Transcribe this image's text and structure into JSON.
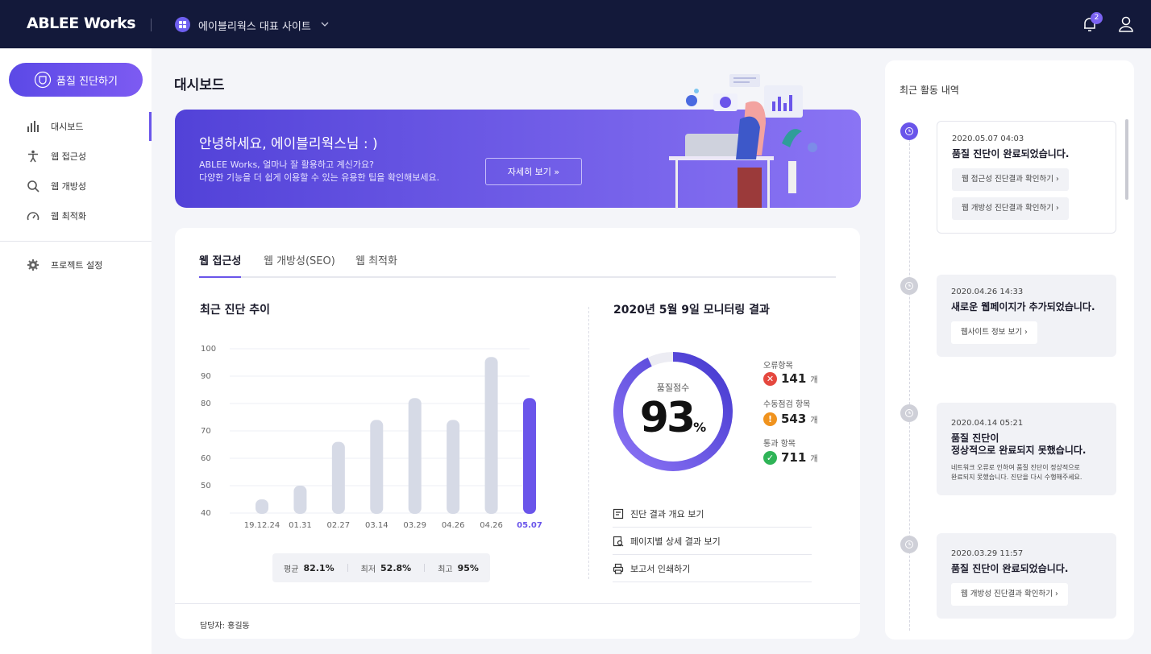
{
  "header": {
    "logo": "ABLEE Works",
    "site_name": "에이블리웍스 대표 사이트",
    "notification_count": "2"
  },
  "sidebar": {
    "cta_label": "품질 진단하기",
    "items": [
      {
        "label": "대시보드",
        "icon": "bar-chart-icon"
      },
      {
        "label": "웹 접근성",
        "icon": "accessibility-icon"
      },
      {
        "label": "웹 개방성",
        "icon": "search-icon"
      },
      {
        "label": "웹 최적화",
        "icon": "gauge-icon"
      },
      {
        "label": "프로젝트 설정",
        "icon": "gear-icon"
      }
    ]
  },
  "main": {
    "title": "대시보드",
    "banner": {
      "greeting": "안녕하세요, 에이블리웍스님 : )",
      "line1": "ABLEE Works, 얼마나 잘 활용하고 계신가요?",
      "line2": "다양한 기능을 더 쉽게 이용할 수 있는 유용한 팁을 확인해보세요.",
      "button": "자세히 보기 »"
    },
    "tabs": [
      "웹 접근성",
      "웹 개방성(SEO)",
      "웹 최적화"
    ],
    "trend_title": "최근 진단 추이",
    "stats": {
      "avg_label": "평균",
      "avg_value": "82.1%",
      "min_label": "최저",
      "min_value": "52.8%",
      "max_label": "최고",
      "max_value": "95%"
    },
    "manager": "담당자: 홍길동",
    "monitor": {
      "title": "2020년 5월 9일 모니터링 결과",
      "score_label": "품질점수",
      "score": "93",
      "score_unit": "%",
      "score_fraction": 0.93,
      "error_label": "오류항목",
      "error_value": "141",
      "manual_label": "수동점검 항목",
      "manual_value": "543",
      "pass_label": "통과 항목",
      "pass_value": "711",
      "unit": "개",
      "links": [
        "진단 결과 개요 보기",
        "페이지별 상세 결과 보기",
        "보고서 인쇄하기"
      ]
    }
  },
  "chart_data": {
    "type": "bar",
    "categories": [
      "19.12.24",
      "01.31",
      "02.27",
      "03.14",
      "03.29",
      "04.26",
      "04.26",
      "05.07"
    ],
    "values": [
      45,
      50,
      66,
      74,
      82,
      74,
      97,
      82
    ],
    "ylim": [
      40,
      100
    ],
    "yticks": [
      "100",
      "90",
      "80",
      "70",
      "60",
      "50",
      "40"
    ],
    "highlight_index": 7,
    "bar_color": "#d6dae6",
    "highlight_color": "#6a55ea",
    "grid": true
  },
  "activity": {
    "title": "최근 활동 내역",
    "items": [
      {
        "date": "2020.05.07 04:03",
        "message": [
          "품질 진단이 완료되었습니다."
        ],
        "buttons": [
          "웹 접근성 진단결과 확인하기 ›",
          "웹 개방성 진단결과 확인하기 ›"
        ]
      },
      {
        "date": "2020.04.26 14:33",
        "message": [
          "새로운 웹페이지가 추가되었습니다."
        ],
        "buttons": [
          "웹사이트 정보 보기  ›"
        ]
      },
      {
        "date": "2020.04.14 05:21",
        "message": [
          "품질 진단이",
          "정상적으로 완료되지 못했습니다."
        ],
        "desc": [
          "네트워크 오류로 인하여 품질 진단이 정상적으로",
          "완료되지 못했습니다. 진단을 다시 수행해주세요."
        ]
      },
      {
        "date": "2020.03.29 11:57",
        "message": [
          "품질 진단이 완료되었습니다."
        ],
        "buttons": [
          "웹 개방성 진단결과 확인하기 ›"
        ]
      }
    ]
  },
  "colors": {
    "accent": "#6a55ea",
    "topbar": "#13193a",
    "error": "#e5483f",
    "manual": "#f0931e",
    "pass": "#2fb457"
  }
}
